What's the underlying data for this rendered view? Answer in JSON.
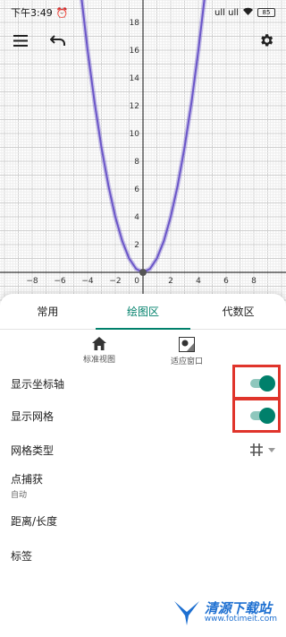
{
  "status_bar": {
    "time": "下午3:49",
    "alarm_icon": "alarm-icon",
    "signal_text": "ull ull",
    "wifi_icon": "wifi-icon",
    "battery": "85"
  },
  "toolbar": {
    "menu_icon": "hamburger-menu-icon",
    "undo_icon": "undo-icon",
    "settings_icon": "gear-icon"
  },
  "chart_data": {
    "type": "line",
    "title": "",
    "xlabel": "",
    "ylabel": "",
    "xlim": [
      -10.5,
      10.5
    ],
    "ylim": [
      -0.3,
      19
    ],
    "x_ticks": [
      -8,
      -6,
      -4,
      -2,
      0,
      2,
      4,
      6,
      8
    ],
    "y_ticks": [
      2,
      4,
      6,
      8,
      10,
      12,
      14,
      16,
      18
    ],
    "grid": true,
    "series": [
      {
        "color": "#6b56c8",
        "x": [
          -4.5,
          -4,
          -3.5,
          -3,
          -2.5,
          -2,
          -1.5,
          -1,
          -0.5,
          0,
          0.5,
          1,
          1.5,
          2,
          2.5,
          3,
          3.5,
          4,
          4.5
        ],
        "y": [
          20.25,
          16,
          12.25,
          9,
          6.25,
          4,
          2.25,
          1,
          0.25,
          0,
          0.25,
          1,
          2.25,
          4,
          6.25,
          9,
          12.25,
          16,
          20.25
        ]
      }
    ],
    "points": [
      {
        "x": 0,
        "y": 0
      }
    ]
  },
  "tabs": [
    {
      "label": "常用"
    },
    {
      "label": "绘图区"
    },
    {
      "label": "代数区"
    }
  ],
  "views": [
    {
      "label": "标准视图",
      "icon": "home-icon"
    },
    {
      "label": "适应窗口",
      "icon": "fit-window-icon"
    }
  ],
  "settings": {
    "show_axes": {
      "label": "显示坐标轴",
      "on": true
    },
    "show_grid": {
      "label": "显示网格",
      "on": true
    },
    "grid_type": {
      "label": "网格类型",
      "icon": "grid-icon"
    },
    "point_capturing": {
      "label": "点捕获",
      "value": "自动"
    },
    "distance_length": {
      "label": "距离/长度"
    },
    "labeling": {
      "label": "标签"
    }
  },
  "watermark": {
    "title": "清源下载站",
    "url": "www.fotimeit.com"
  },
  "colors": {
    "accent": "#00806b",
    "curve": "#6b56c8",
    "highlight": "#e0342b",
    "watermark": "#1d6fd1"
  }
}
